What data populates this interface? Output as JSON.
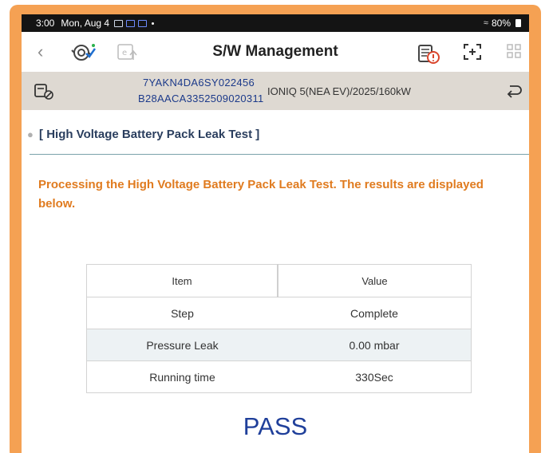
{
  "status_bar": {
    "time": "3:00",
    "date": "Mon, Aug 4",
    "battery": "80%"
  },
  "header": {
    "title": "S/W Management"
  },
  "vehicle": {
    "vin_line1": "7YAKN4DA6SY022456",
    "vin_line2": "B28AACA3352509020311",
    "model": "IONIQ 5(NEA EV)/2025/160kW"
  },
  "section": {
    "title": "[ High Voltage Battery Pack Leak Test ]"
  },
  "message": "Processing the High Voltage Battery Pack Leak Test. The results are displayed below.",
  "table": {
    "headers": [
      "Item",
      "Value"
    ],
    "rows": [
      {
        "item": "Step",
        "value": "Complete"
      },
      {
        "item": "Pressure Leak",
        "value": "0.00 mbar"
      },
      {
        "item": "Running time",
        "value": "330Sec"
      }
    ]
  },
  "result": "PASS",
  "colors": {
    "frame": "#f5a153",
    "message": "#e07b1f",
    "result": "#1f3f9a",
    "vin": "#1c3a8a"
  }
}
